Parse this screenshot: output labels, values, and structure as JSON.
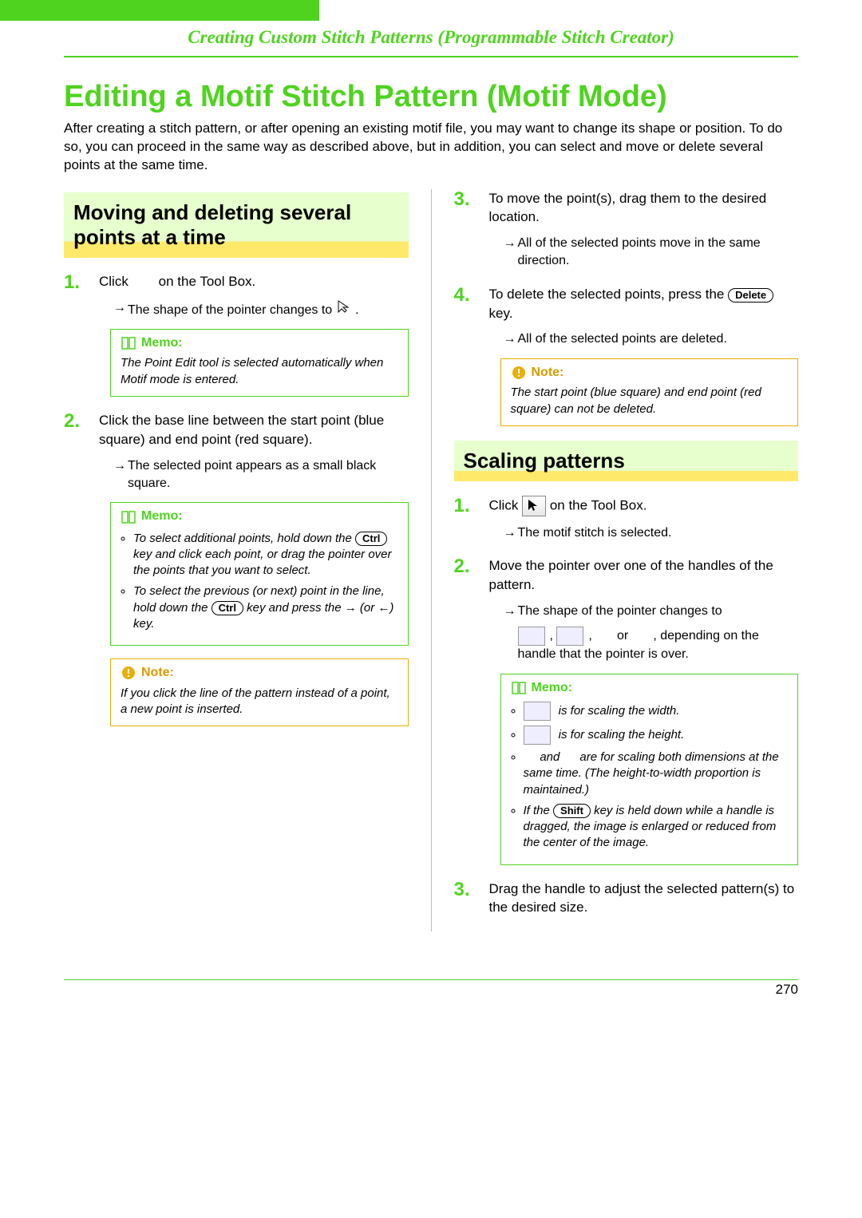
{
  "header": {
    "section_title": "Creating Custom Stitch Patterns (Programmable Stitch Creator)"
  },
  "page_title": "Editing a Motif Stitch Pattern (Motif Mode)",
  "intro": "After creating a stitch pattern, or after opening an existing motif file, you may want to change its shape or position. To do so, you can proceed in the same way as described above, but in addition, you can select and move or delete several points at the same time.",
  "left": {
    "section": "Moving and deleting several points at a time",
    "step1": {
      "pre": "Click",
      "post": "on the Tool Box.",
      "sub": "The shape of the pointer changes to",
      "memo_label": "Memo:",
      "memo_body": "The Point Edit tool is selected automatically when Motif mode is entered."
    },
    "step2": {
      "text": "Click the base line between the start point (blue square) and end point (red square).",
      "sub": "The selected point appears as a small black square.",
      "memo_label": "Memo:",
      "memo_b1a": "To select additional points, hold down the",
      "memo_b1_key": "Ctrl",
      "memo_b1b": "key and click each point, or drag the pointer over the points that you want to select.",
      "memo_b2a": "To select the previous (or next) point in the line, hold down the",
      "memo_b2_key": "Ctrl",
      "memo_b2b": "key and press the → (or ←) key.",
      "note_label": "Note:",
      "note_body": "If you click the line of the pattern instead of a point, a new point is inserted."
    }
  },
  "right": {
    "step3": {
      "text": "To move the point(s), drag them to the desired location.",
      "sub": "All of the selected points move in the same direction."
    },
    "step4": {
      "pre": "To delete the selected points, press the",
      "key": "Delete",
      "post": "key.",
      "sub": "All of the selected points are deleted.",
      "note_label": "Note:",
      "note_body": "The start point (blue square) and end point (red square) can not be deleted."
    },
    "scaling_head": "Scaling patterns",
    "s1": {
      "pre": "Click",
      "post": "on the Tool Box.",
      "sub": "The motif stitch is selected."
    },
    "s2": {
      "text": "Move the pointer over one of the handles of the pattern.",
      "sub": "The shape of the pointer changes to",
      "tail_sep": ",",
      "tail_or": "or",
      "tail_end": ", depending on the handle that the pointer is over.",
      "memo_label": "Memo:",
      "m1": "is for scaling the width.",
      "m2": "is for scaling the height.",
      "m3_and": "and",
      "m3_rest": "are for scaling both dimensions at the same time. (The height-to-width proportion is maintained.)",
      "m4a": "If the",
      "m4_key": "Shift",
      "m4b": "key is held down while a handle is dragged, the image is enlarged or reduced from the center of the image."
    },
    "s3": {
      "text": "Drag the handle to adjust the selected pattern(s) to the desired size."
    }
  },
  "page_number": "270"
}
